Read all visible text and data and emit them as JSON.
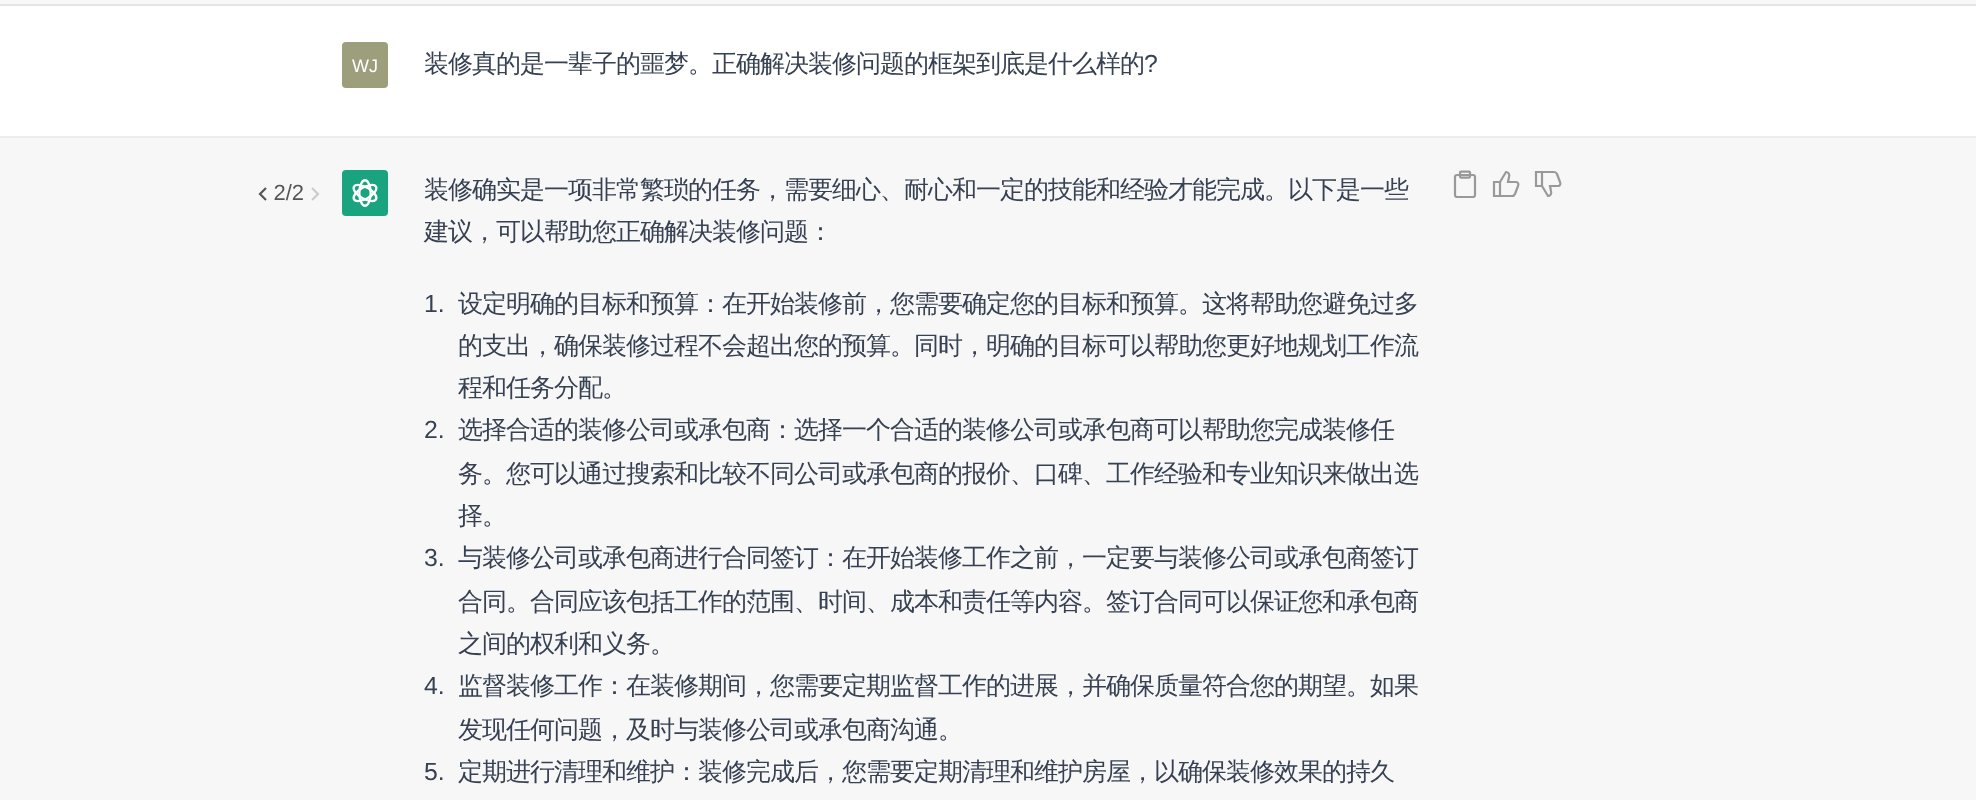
{
  "conversation": [
    {
      "kind": "user",
      "avatar": "WJ",
      "text": "装修真的是一辈子的噩梦。正确解决装修问题的框架到底是什么样的?"
    },
    {
      "kind": "assistant",
      "pager": "2/2",
      "intro": "装修确实是一项非常繁琐的任务，需要细心、耐心和一定的技能和经验才能完成。以下是一些建议，可以帮助您正确解决装修问题：",
      "items": [
        {
          "number": "1.",
          "text": "设定明确的目标和预算：在开始装修前，您需要确定您的目标和预算。这将帮助您避免过多的支出，确保装修过程不会超出您的预算。同时，明确的目标可以帮助您更好地规划工作流程和任务分配。"
        },
        {
          "number": "2.",
          "text": "选择合适的装修公司或承包商：选择一个合适的装修公司或承包商可以帮助您完成装修任务。您可以通过搜索和比较不同公司或承包商的报价、口碑、工作经验和专业知识来做出选择。"
        },
        {
          "number": "3.",
          "text": "与装修公司或承包商进行合同签订：在开始装修工作之前，一定要与装修公司或承包商签订合同。合同应该包括工作的范围、时间、成本和责任等内容。签订合同可以保证您和承包商之间的权利和义务。"
        },
        {
          "number": "4.",
          "text": "监督装修工作：在装修期间，您需要定期监督工作的进展，并确保质量符合您的期望。如果发现任何问题，及时与装修公司或承包商沟通。"
        },
        {
          "number": "5.",
          "text": "定期进行清理和维护：装修完成后，您需要定期清理和维护房屋，以确保装修效果的持久"
        }
      ]
    }
  ]
}
